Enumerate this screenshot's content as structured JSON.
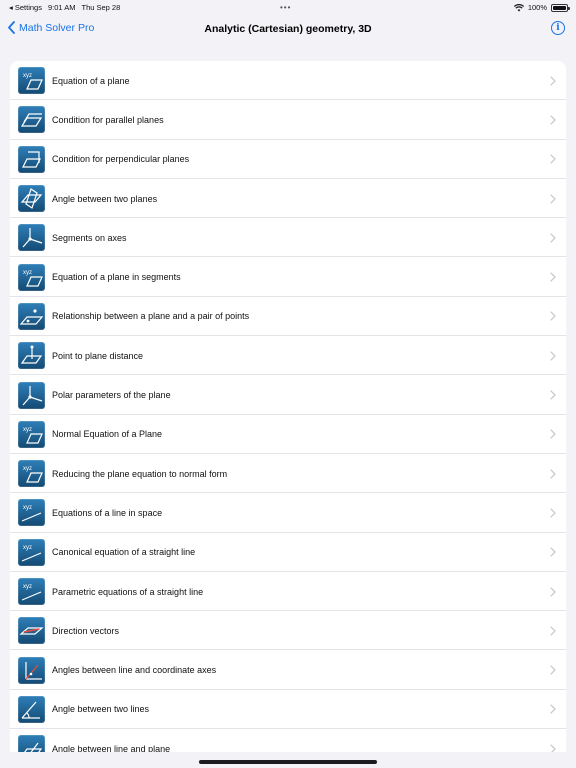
{
  "status": {
    "back_app": "Settings",
    "time": "9:01 AM",
    "date": "Thu Sep 28",
    "battery": "100%"
  },
  "nav": {
    "back_label": "Math Solver Pro",
    "title": "Analytic (Cartesian) geometry, 3D",
    "info_glyph": "i"
  },
  "items": [
    {
      "label": "Equation of a plane",
      "icon": "xyz-plane-icon"
    },
    {
      "label": "Condition for parallel planes",
      "icon": "parallel-planes-icon"
    },
    {
      "label": "Condition for perpendicular planes",
      "icon": "perpendicular-planes-icon"
    },
    {
      "label": "Angle between two planes",
      "icon": "plane-angle-icon"
    },
    {
      "label": "Segments on axes",
      "icon": "axes-icon"
    },
    {
      "label": "Equation of a plane in segments",
      "icon": "xyz-plane-icon"
    },
    {
      "label": "Relationship between a plane and a pair of points",
      "icon": "plane-points-icon"
    },
    {
      "label": "Point to plane distance",
      "icon": "point-distance-icon"
    },
    {
      "label": "Polar parameters of the plane",
      "icon": "axes-icon"
    },
    {
      "label": "Normal Equation of a Plane",
      "icon": "xyz-plane-icon"
    },
    {
      "label": "Reducing the plane equation to normal form",
      "icon": "xyz-plane-icon"
    },
    {
      "label": "Equations of a line in space",
      "icon": "xyz-line-icon"
    },
    {
      "label": "Canonical equation of a straight line",
      "icon": "xyz-line-icon"
    },
    {
      "label": "Parametric equations of a straight line",
      "icon": "xyz-line-icon"
    },
    {
      "label": "Direction vectors",
      "icon": "direction-vectors-icon"
    },
    {
      "label": "Angles between line and coordinate axes",
      "icon": "line-axes-angle-icon"
    },
    {
      "label": "Angle between two lines",
      "icon": "line-angle-icon"
    },
    {
      "label": "Angle between line and plane",
      "icon": "line-plane-angle-icon"
    }
  ],
  "icon_text": {
    "xyz": "xyz"
  },
  "colors": {
    "accent": "#1a73e8",
    "icon_top": "#2f7fb8",
    "icon_bottom": "#134a73"
  }
}
